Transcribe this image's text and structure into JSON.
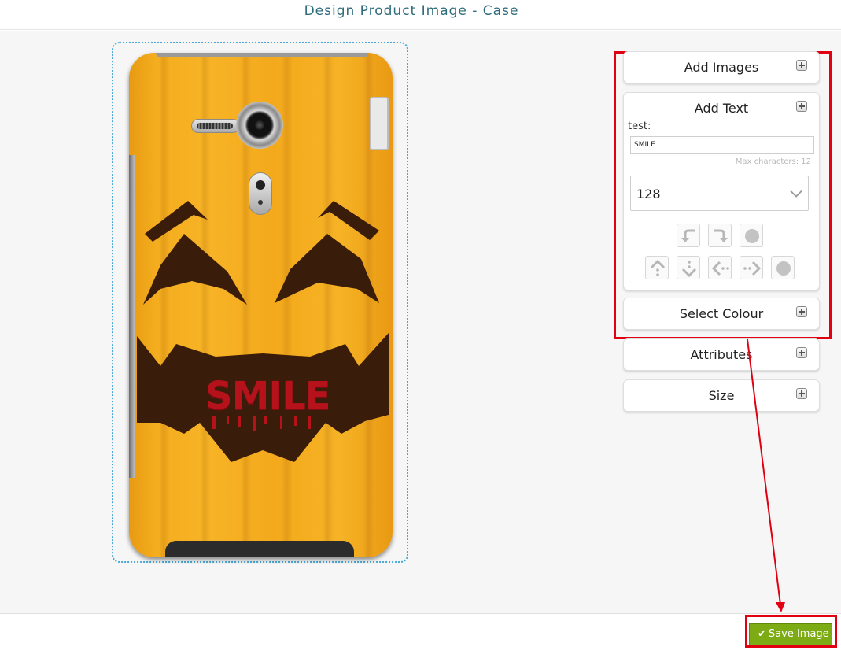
{
  "header": {
    "title": "Design Product Image - Case"
  },
  "preview": {
    "case_text": "SMILE"
  },
  "panel": {
    "add_images": {
      "label": "Add Images",
      "icon": "expand-icon"
    },
    "add_text": {
      "label": "Add Text",
      "icon": "expand-icon",
      "field_label": "test:",
      "text_value": "SMILE",
      "max_chars_note": "Max characters: 12",
      "font_size_value": "128",
      "controls_row1": [
        "rotate-left-icon",
        "rotate-right-icon",
        "reset-rotation-icon"
      ],
      "controls_row2": [
        "move-up-icon",
        "move-down-icon",
        "move-left-icon",
        "move-right-icon",
        "center-icon"
      ]
    },
    "select_colour": {
      "label": "Select Colour",
      "icon": "expand-icon"
    },
    "attributes": {
      "label": "Attributes",
      "icon": "expand-icon"
    },
    "size": {
      "label": "Size",
      "icon": "expand-icon"
    }
  },
  "footer": {
    "save_label": "Save Image",
    "save_icon": "checkmark-icon"
  },
  "colors": {
    "accent_green": "#7cab13",
    "highlight_red": "#e00012",
    "title_teal": "#2c6b7a"
  }
}
